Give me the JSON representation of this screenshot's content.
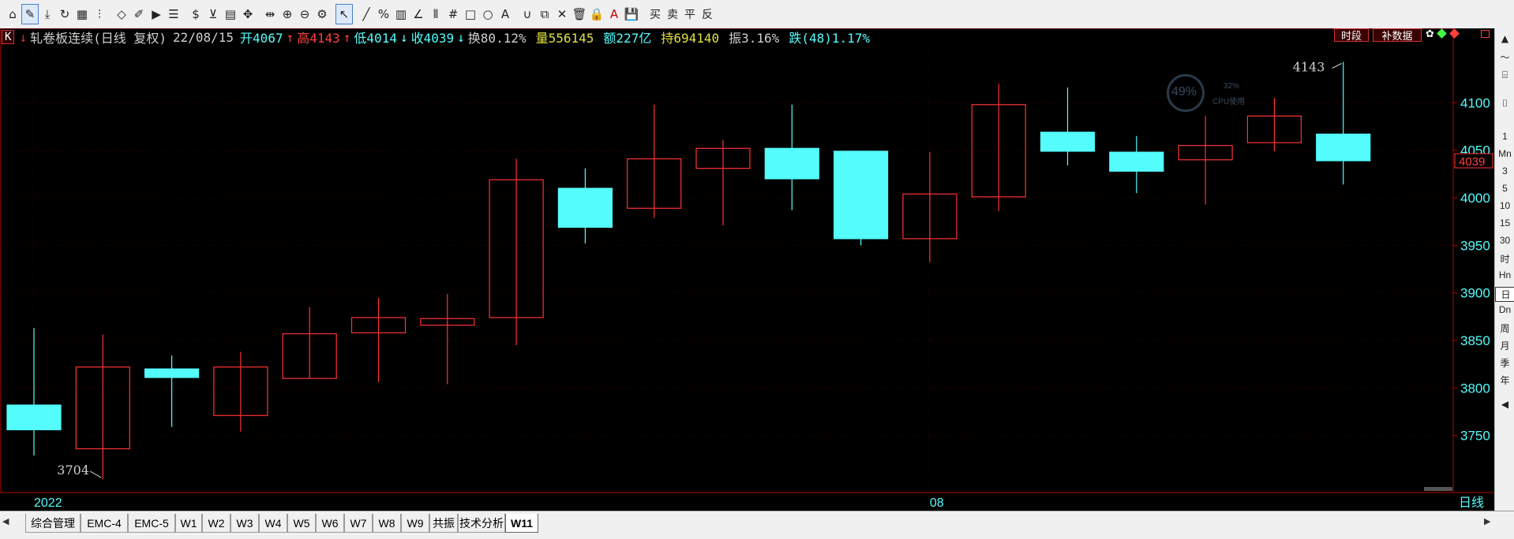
{
  "toolbar": {
    "icons": [
      "home-icon",
      "pen-icon",
      "download-icon",
      "refresh-icon",
      "grid-icon",
      "indicator-icon",
      "diamond-icon",
      "edit-icon",
      "play-icon",
      "notes-icon",
      "dollar-icon",
      "filter-icon",
      "table-icon",
      "move-icon",
      "cursor-range-icon",
      "zoom-in-icon",
      "zoom-out-icon",
      "settings-icon",
      "pointer-icon",
      "line-tool-icon",
      "percent-icon",
      "fib-icon",
      "angle-icon",
      "channel-icon",
      "hash-icon",
      "rectangle-icon",
      "ellipse-icon",
      "text-tool-icon",
      "magnet-icon",
      "copy-icon",
      "delete-icon",
      "trash-icon",
      "lock-icon",
      "color-icon",
      "save-icon"
    ],
    "dollar_label": "$",
    "text_label": "A",
    "buy_label": "买",
    "sell_label": "卖",
    "close_label": "平",
    "reverse_label": "反"
  },
  "info": {
    "k_badge": "K",
    "title": "轧卷板连续(日线 复权)",
    "date": "22/08/15",
    "open": "开4067",
    "high": "高4143",
    "low": "低4014",
    "close": "收4039",
    "turnover": "换80.12%",
    "volume": "量556145",
    "amount": "额227亿",
    "hold": "持694140",
    "amplitude": "振3.16%",
    "change": "跌(48)1.17%",
    "btn_period": "时段",
    "btn_fill": "补数据"
  },
  "cpu": {
    "main": "49%",
    "sub": "32%",
    "label": "CPU使用"
  },
  "chart_data": {
    "type": "candlestick",
    "title": "轧卷板连续(日线 复权)",
    "y_ticks": [
      3750,
      3800,
      3850,
      3900,
      3950,
      4000,
      4050,
      4100
    ],
    "ylim": [
      3690,
      4160
    ],
    "x_labels": [
      {
        "index": 0,
        "text": "2022"
      },
      {
        "index": 13,
        "text": "08"
      }
    ],
    "period_label": "日线",
    "last_price": "4039",
    "annotations": [
      {
        "index": 1,
        "value": 3704,
        "text": "3704"
      },
      {
        "index": 19,
        "value": 4143,
        "text": "4143"
      }
    ],
    "candles": [
      {
        "open": 3782,
        "close": 3756,
        "high": 3863,
        "low": 3729
      },
      {
        "open": 3736,
        "close": 3822,
        "high": 3856,
        "low": 3704
      },
      {
        "open": 3820,
        "close": 3811,
        "high": 3834,
        "low": 3759
      },
      {
        "open": 3771,
        "close": 3822,
        "high": 3838,
        "low": 3754
      },
      {
        "open": 3810,
        "close": 3857,
        "high": 3885,
        "low": 3810
      },
      {
        "open": 3858,
        "close": 3874,
        "high": 3895,
        "low": 3806
      },
      {
        "open": 3866,
        "close": 3873,
        "high": 3899,
        "low": 3804
      },
      {
        "open": 3874,
        "close": 4019,
        "high": 4041,
        "low": 3845
      },
      {
        "open": 4010,
        "close": 3969,
        "high": 4031,
        "low": 3952
      },
      {
        "open": 3989,
        "close": 4041,
        "high": 4098,
        "low": 3979
      },
      {
        "open": 4031,
        "close": 4052,
        "high": 4061,
        "low": 3971
      },
      {
        "open": 4052,
        "close": 4020,
        "high": 4098,
        "low": 3987
      },
      {
        "open": 4049,
        "close": 3957,
        "high": 4049,
        "low": 3950
      },
      {
        "open": 3957,
        "close": 4004,
        "high": 4048,
        "low": 3932
      },
      {
        "open": 4001,
        "close": 4098,
        "high": 4120,
        "low": 3986
      },
      {
        "open": 4069,
        "close": 4049,
        "high": 4116,
        "low": 4034
      },
      {
        "open": 4048,
        "close": 4028,
        "high": 4065,
        "low": 4005
      },
      {
        "open": 4040,
        "close": 4055,
        "high": 4086,
        "low": 3993
      },
      {
        "open": 4058,
        "close": 4086,
        "high": 4105,
        "low": 4049
      },
      {
        "open": 4067,
        "close": 4039,
        "high": 4143,
        "low": 4014
      }
    ]
  },
  "tabs": [
    "综合管理",
    "EMC-4",
    "EMC-5",
    "W1",
    "W2",
    "W3",
    "W4",
    "W5",
    "W6",
    "W7",
    "W8",
    "W9",
    "共振",
    "技术分析",
    "W11"
  ],
  "right_bar": [
    "1",
    "Mn",
    "3",
    "5",
    "10",
    "15",
    "30",
    "时",
    "Hn",
    "日",
    "Dn",
    "周",
    "月",
    "季",
    "年"
  ],
  "colors": {
    "up": "#ff3232",
    "down": "#54fcfc",
    "axis": "#b00000",
    "bg": "#000000"
  }
}
